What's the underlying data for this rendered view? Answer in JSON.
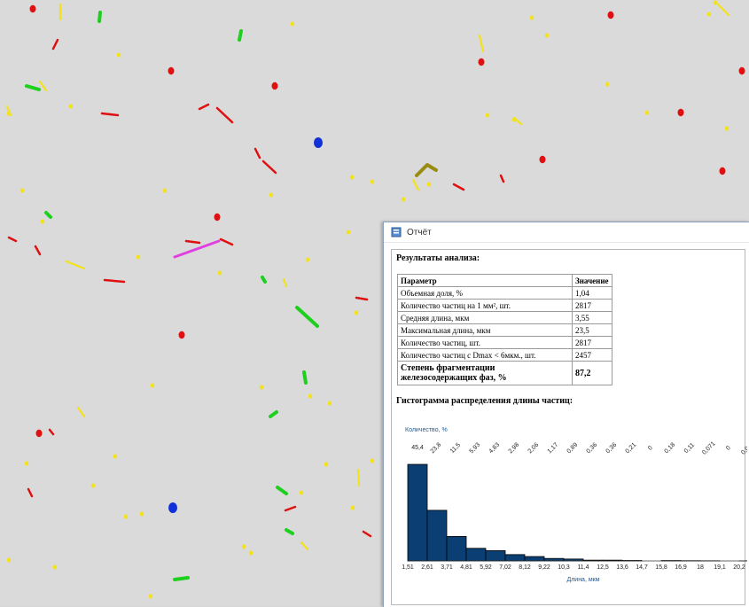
{
  "window": {
    "title": "Отчёт",
    "icon": "report-window-icon"
  },
  "report": {
    "results_heading": "Результаты анализа:",
    "table": {
      "headers": [
        "Параметр",
        "Значение"
      ],
      "rows": [
        {
          "param": "Объемная доля, %",
          "value": "1,04"
        },
        {
          "param": "Количество частиц на 1 мм², шт.",
          "value": "2817"
        },
        {
          "param": "Средняя длина, мкм",
          "value": "3,55"
        },
        {
          "param": "Максимальная длина, мкм",
          "value": "23,5"
        },
        {
          "param": "Количество частиц, шт.",
          "value": "2817"
        },
        {
          "param": "Количество частиц с Dmax < 6мкм., шт.",
          "value": "2457"
        },
        {
          "param": "Степень фрагментации железосодержащих фаз, %",
          "value": "87,2"
        }
      ]
    },
    "histogram_heading": "Гистограмма распределения длины частиц:"
  },
  "colors": {
    "bar_fill": "#0b3f73",
    "axis_title": "#1f5a94",
    "particle_red": "#e01010",
    "particle_yellow": "#f2e21a",
    "particle_green": "#1ed01e",
    "particle_blue": "#1030d8",
    "particle_magenta": "#e040e0",
    "particle_olive": "#9a8c10"
  },
  "chart_data": {
    "type": "bar",
    "ylabel": "Количество, %",
    "xlabel": "Длина, мкм",
    "categories": [
      "1,51",
      "2,61",
      "3,71",
      "4,81",
      "5,92",
      "7,02",
      "8,12",
      "9,22",
      "10,3",
      "11,4",
      "12,5",
      "13,6",
      "14,7",
      "15,8",
      "16,9",
      "18",
      "19,1",
      "20,2",
      "21,3"
    ],
    "values": [
      45.4,
      23.8,
      11.5,
      5.93,
      4.83,
      2.98,
      2.06,
      1.17,
      0.89,
      0.36,
      0.36,
      0.21,
      0,
      0.18,
      0.11,
      0.071,
      0,
      0.036
    ],
    "value_labels": [
      "45,4",
      "23,8",
      "11,5",
      "5,93",
      "4,83",
      "2,98",
      "2,06",
      "1,17",
      "0,89",
      "0,36",
      "0,36",
      "0,21",
      "0",
      "0,18",
      "0,11",
      "0,071",
      "0",
      "0,036"
    ],
    "ylim": [
      0,
      50
    ],
    "grid": false,
    "legend": "none"
  }
}
